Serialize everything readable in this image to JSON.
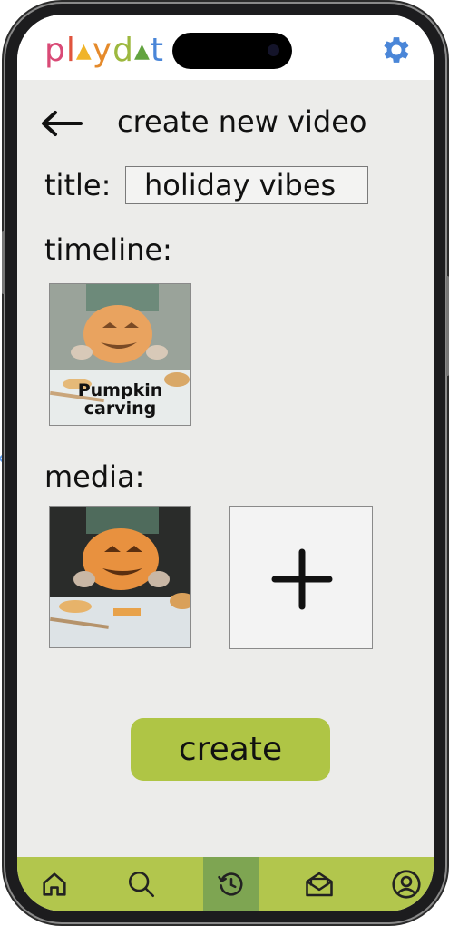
{
  "app": {
    "logo_letters": [
      {
        "char": "p",
        "color": "#d94a76"
      },
      {
        "char": "l",
        "color": "#e0543e"
      },
      {
        "char": "▲",
        "color": "#f0b429"
      },
      {
        "char": "y",
        "color": "#e58a2b"
      },
      {
        "char": "d",
        "color": "#9db83f"
      },
      {
        "char": "▲",
        "color": "#62a33f"
      },
      {
        "char": "t",
        "color": "#4a86d8"
      }
    ],
    "settings_icon": "gear-icon",
    "accent_color": "#afc545"
  },
  "screen": {
    "title": "create new video",
    "back_icon": "arrow-left-icon"
  },
  "form": {
    "title_label": "title:",
    "title_value": "holiday vibes",
    "timeline_label": "timeline:",
    "timeline_items": [
      {
        "caption": "Pumpkin carving",
        "image": "pumpkin-carving-photo"
      }
    ],
    "media_label": "media:",
    "media_items": [
      {
        "image": "pumpkin-carving-photo"
      }
    ],
    "add_media_icon": "plus-icon",
    "create_label": "create"
  },
  "nav": {
    "items": [
      {
        "icon": "home-icon",
        "active": false
      },
      {
        "icon": "search-icon",
        "active": false
      },
      {
        "icon": "history-icon",
        "active": true
      },
      {
        "icon": "mail-icon",
        "active": false
      },
      {
        "icon": "profile-icon",
        "active": false
      }
    ],
    "bar_color": "#b2c64d",
    "active_color": "#7ea552"
  }
}
